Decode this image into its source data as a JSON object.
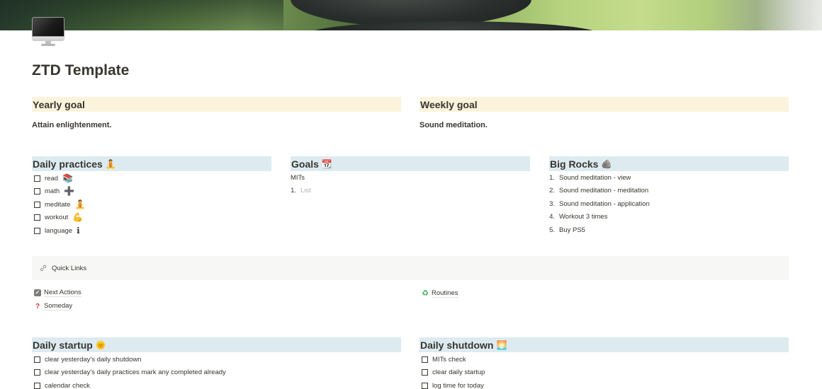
{
  "page": {
    "title": "ZTD Template",
    "icon": "desktop-computer-icon"
  },
  "goals": {
    "yearly": {
      "label": "Yearly goal",
      "text": "Attain enlightenment."
    },
    "weekly": {
      "label": "Weekly goal",
      "text": "Sound meditation."
    }
  },
  "daily_practices": {
    "title": "Daily practices",
    "emoji": "🧘",
    "items": [
      {
        "label": "read",
        "emoji": "📚",
        "checked": false
      },
      {
        "label": "math",
        "emoji": "➕",
        "checked": false
      },
      {
        "label": "meditate",
        "emoji": "🧘",
        "checked": false
      },
      {
        "label": "workout",
        "emoji": "💪",
        "checked": false
      },
      {
        "label": "language",
        "emoji": "ℹ",
        "checked": false
      }
    ]
  },
  "goals_section": {
    "title": "Goals",
    "emoji": "📆",
    "subtitle": "MITs",
    "list": [
      {
        "num": "1.",
        "placeholder": "List"
      }
    ]
  },
  "big_rocks": {
    "title": "Big Rocks",
    "emoji": "🪨",
    "items": [
      {
        "num": "1.",
        "label": "Sound meditation - view"
      },
      {
        "num": "2.",
        "label": "Sound meditation - meditation"
      },
      {
        "num": "3.",
        "label": "Sound meditation - application"
      },
      {
        "num": "4.",
        "label": "Workout 3 times"
      },
      {
        "num": "5.",
        "label": "Buy PS5"
      }
    ]
  },
  "quick_links": {
    "title": "Quick Links",
    "icon": "link-icon",
    "links": [
      {
        "label": "Next Actions",
        "icon": "checkbox-checked-icon",
        "glyph": "✓"
      },
      {
        "label": "Someday",
        "icon": "question-mark-icon",
        "glyph": "?"
      },
      {
        "label": "Routines",
        "icon": "recycle-icon",
        "glyph": "♻"
      }
    ]
  },
  "daily_startup": {
    "title": "Daily startup",
    "emoji": "🌞",
    "items": [
      {
        "label": "clear yesterday's daily shutdown",
        "checked": false
      },
      {
        "label": "clear yesterday's daily practices mark any completed already",
        "checked": false
      },
      {
        "label": "calendar check",
        "checked": false
      }
    ]
  },
  "daily_shutdown": {
    "title": "Daily shutdown",
    "emoji": "🌅",
    "items": [
      {
        "label": "MITs check",
        "checked": false
      },
      {
        "label": "clear daily startup",
        "checked": false
      },
      {
        "label": "log time for today",
        "checked": false
      }
    ]
  }
}
